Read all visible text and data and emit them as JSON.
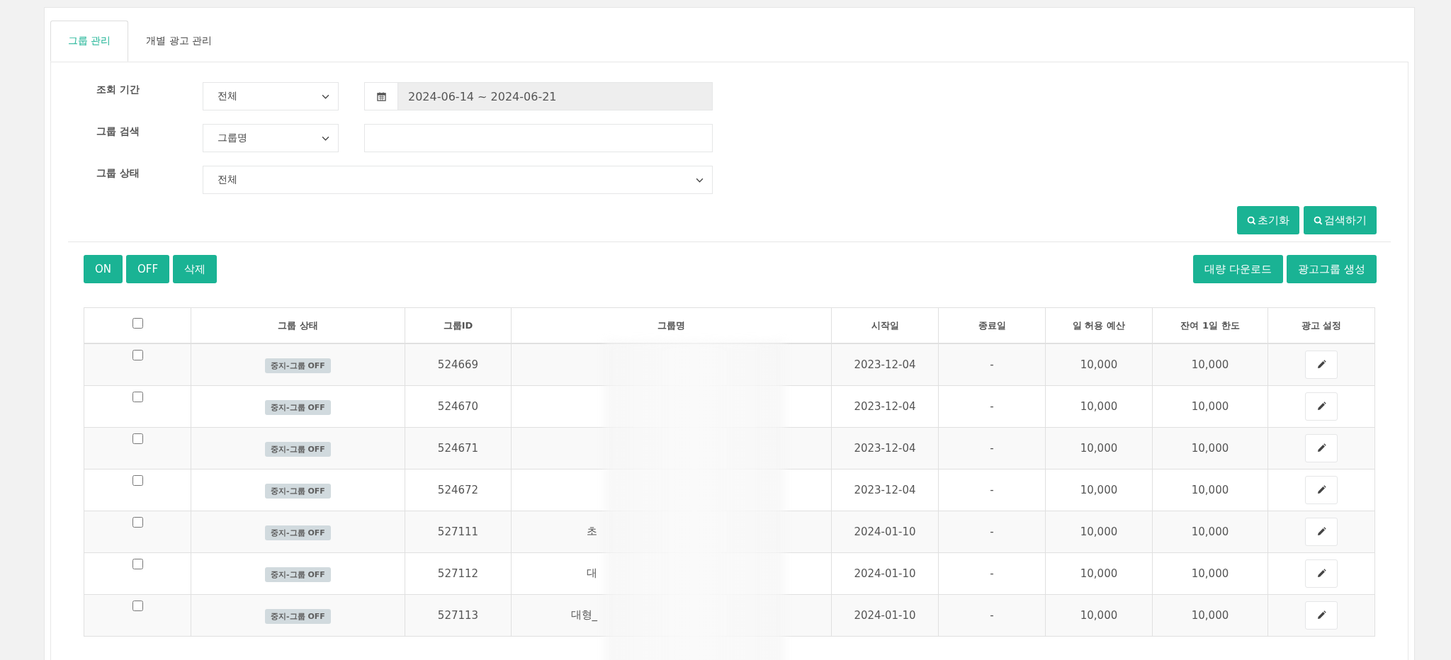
{
  "tabs": [
    {
      "label": "그룹 관리",
      "selected": true
    },
    {
      "label": "개별 광고 관리",
      "selected": false
    }
  ],
  "filters": {
    "period": {
      "label": "조회 기간",
      "select": "전체",
      "date_range": "2024-06-14 ~ 2024-06-21"
    },
    "search": {
      "label": "그룹 검색",
      "select": "그룹명"
    },
    "status": {
      "label": "그룹 상태",
      "select": "전체"
    }
  },
  "search_buttons": [
    "초기화",
    "검색하기"
  ],
  "left_actions": [
    "ON",
    "OFF",
    "삭제"
  ],
  "right_actions": [
    "대량 다운로드",
    "광고그룹 생성"
  ],
  "table": {
    "header_checked": false,
    "columns": [
      "그룹 상태",
      "그룹ID",
      "그룹명",
      "시작일",
      "종료일",
      "일 허용 예산",
      "잔여 1일 한도",
      "광고 설정"
    ],
    "rows": [
      {
        "checked": false,
        "status": "중지-그룹 OFF",
        "id": "524669",
        "name": "",
        "start": "2023-12-04",
        "end": "-",
        "budget": "10,000",
        "remaining": "10,000"
      },
      {
        "checked": false,
        "status": "중지-그룹 OFF",
        "id": "524670",
        "name": "",
        "start": "2023-12-04",
        "end": "-",
        "budget": "10,000",
        "remaining": "10,000"
      },
      {
        "checked": false,
        "status": "중지-그룹 OFF",
        "id": "524671",
        "name": "",
        "start": "2023-12-04",
        "end": "-",
        "budget": "10,000",
        "remaining": "10,000"
      },
      {
        "checked": false,
        "status": "중지-그룹 OFF",
        "id": "524672",
        "name": "",
        "start": "2023-12-04",
        "end": "-",
        "budget": "10,000",
        "remaining": "10,000"
      },
      {
        "checked": false,
        "status": "중지-그룹 OFF",
        "id": "527111",
        "name": "초",
        "start": "2024-01-10",
        "end": "-",
        "budget": "10,000",
        "remaining": "10,000"
      },
      {
        "checked": false,
        "status": "중지-그룹 OFF",
        "id": "527112",
        "name": "대",
        "start": "2024-01-10",
        "end": "-",
        "budget": "10,000",
        "remaining": "10,000"
      },
      {
        "checked": false,
        "status": "중지-그룹 OFF",
        "id": "527113",
        "name": "대형_",
        "start": "2024-01-10",
        "end": "-",
        "budget": "10,000",
        "remaining": "10,000"
      }
    ]
  }
}
